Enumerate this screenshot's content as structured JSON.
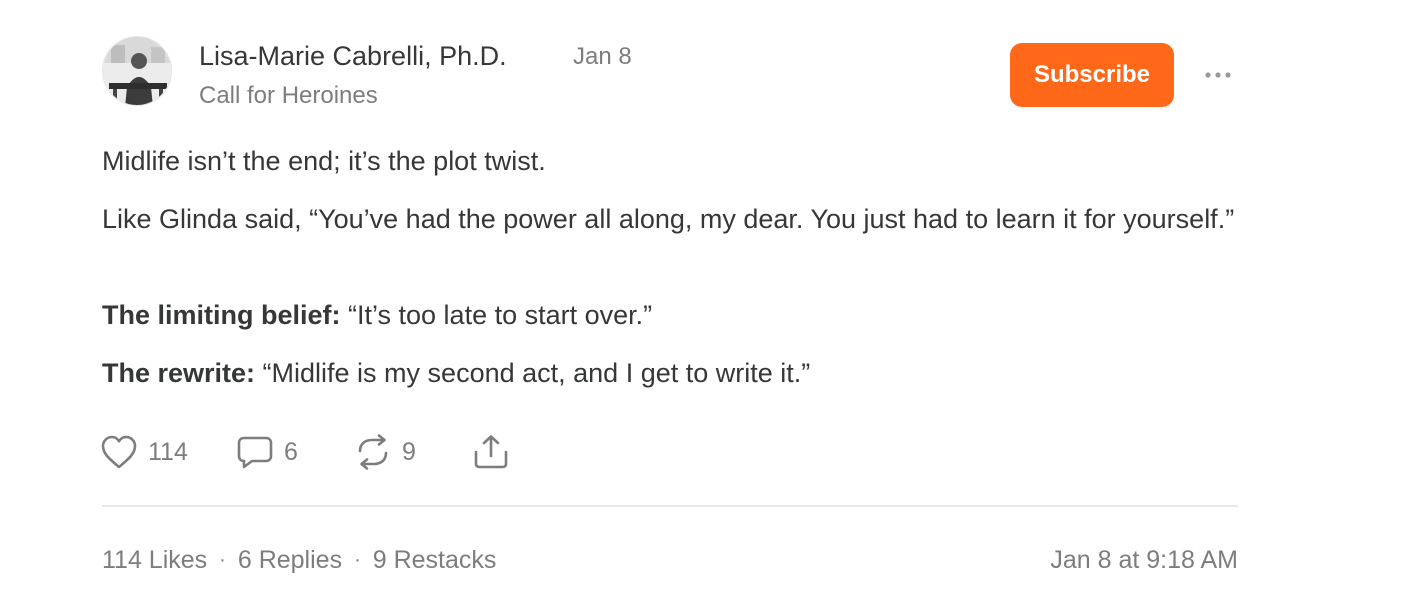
{
  "author": {
    "name": "Lisa-Marie Cabrelli, Ph.D.",
    "publication": "Call for Heroines",
    "date": "Jan 8"
  },
  "header": {
    "subscribe_label": "Subscribe",
    "more_icon": "ellipsis-icon"
  },
  "post": {
    "line1": "Midlife isn’t the end; it’s the plot twist.",
    "line2": "Like Glinda said, “You’ve had the power all along, my dear. You just had to learn it for yourself.”",
    "belief_label": "The limiting belief:",
    "belief_text": " “It’s too late to start over.”",
    "rewrite_label": "The rewrite:",
    "rewrite_text": " “Midlife is my second act, and I get to write it.”"
  },
  "actions": {
    "likes": "114",
    "replies": "6",
    "restacks": "9",
    "icons": [
      "heart-icon",
      "comment-icon",
      "restack-icon",
      "share-icon"
    ]
  },
  "footer": {
    "likes": "114 Likes",
    "replies": "6 Replies",
    "restacks": "9 Restacks",
    "separator": "·",
    "timestamp": "Jan 8 at 9:18 AM"
  },
  "colors": {
    "accent": "#ff6719",
    "text": "#363737",
    "muted": "#7d7d7d",
    "divider": "#e8e8e8"
  }
}
